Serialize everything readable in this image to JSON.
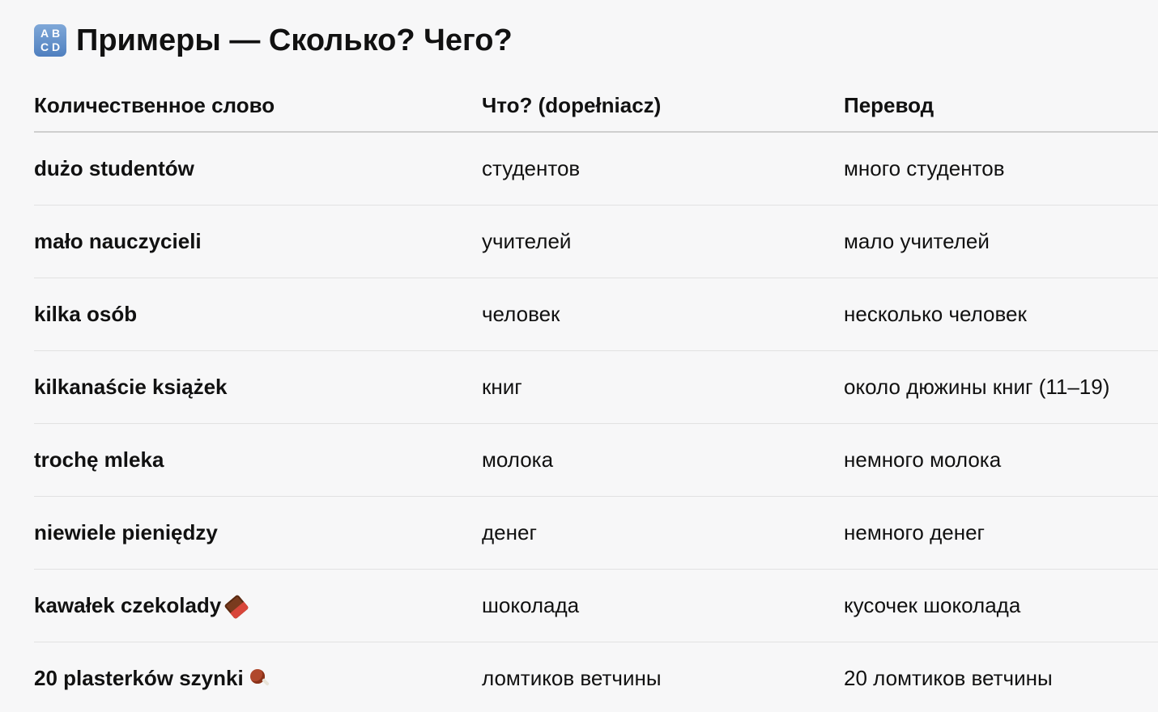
{
  "header": {
    "icon": "abcd-icon",
    "icon_letters": [
      "A",
      "B",
      "C",
      "D"
    ],
    "title": "Примеры — Сколько? Чего?"
  },
  "table": {
    "columns": [
      "Количественное слово",
      "Что? (dopełniacz)",
      "Перевод"
    ],
    "rows": [
      {
        "word": "dużo studentów",
        "genitive": "студентов",
        "translation": "много студентов"
      },
      {
        "word": "mało nauczycieli",
        "genitive": "учителей",
        "translation": "мало учителей"
      },
      {
        "word": "kilka osób",
        "genitive": "человек",
        "translation": "несколько человек"
      },
      {
        "word": "kilkanaście książek",
        "genitive": "книг",
        "translation": "около дюжины книг (11–19)"
      },
      {
        "word": "trochę mleka",
        "genitive": "молока",
        "translation": "немного молока"
      },
      {
        "word": "niewiele pieniędzy",
        "genitive": "денег",
        "translation": "немного денег"
      },
      {
        "word": "kawałek czekolady",
        "icon": "chocolate-bar-icon",
        "genitive": "шоколада",
        "translation": "кусочек шоколада"
      },
      {
        "word": "20 plasterków szynki",
        "icon": "meat-on-bone-icon",
        "genitive": "ломтиков ветчины",
        "translation": "20 ломтиков ветчины"
      }
    ]
  }
}
